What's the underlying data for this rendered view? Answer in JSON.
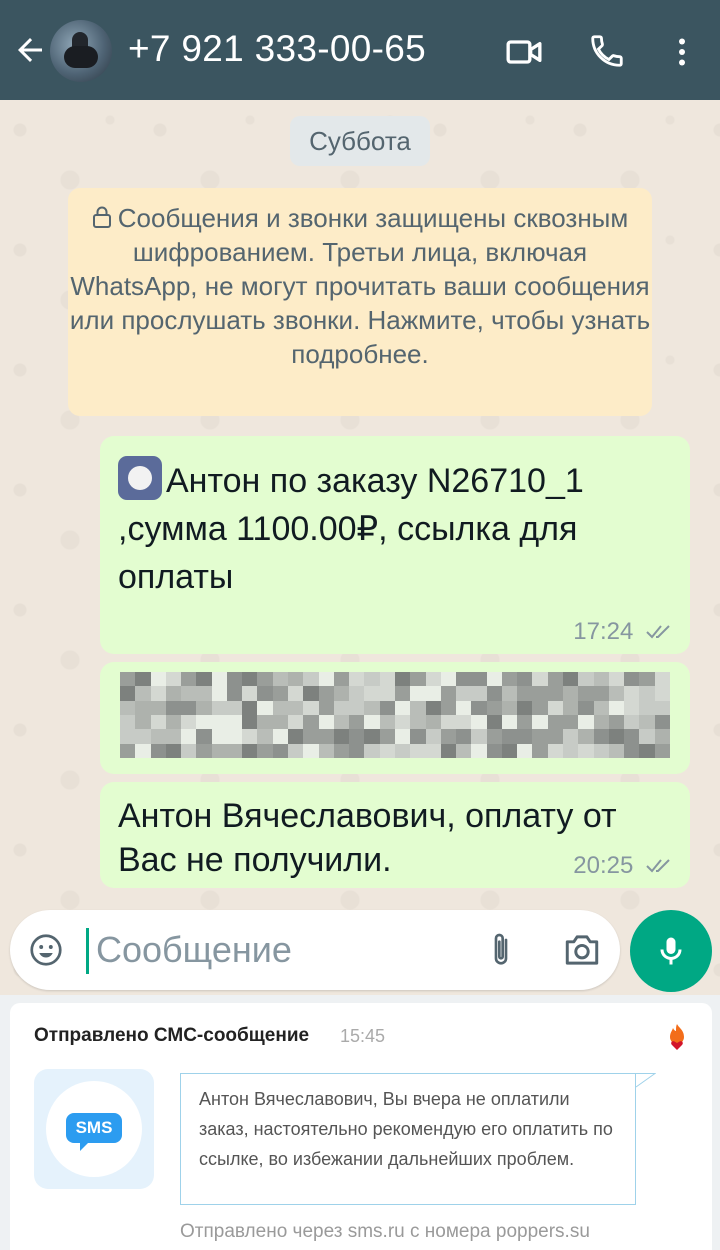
{
  "header": {
    "contact_name": "+7 921 333-00-65",
    "icons": [
      "back-arrow-icon",
      "video-call-icon",
      "phone-icon",
      "more-vert-icon"
    ],
    "bar_color": "#3b5560"
  },
  "chat": {
    "date_label": "Суббота",
    "encryption_notice": "Сообщения и звонки защищены сквозным шифрованием. Третьи лица, включая WhatsApp, не могут прочитать ваши сообщения или прослушать звонки. Нажмите, чтобы узнать подробнее.",
    "messages": [
      {
        "text": "Антон по заказу N26710_1 ,сумма 1100.00₽, ссылка для оплаты",
        "time": "17:24",
        "status": "read-double-tick",
        "emoji": "radio-button-emoji"
      },
      {
        "text": "",
        "obscured": true,
        "content": "pixelated-link"
      },
      {
        "text": "Антон Вячеславович, оплату от Вас не получили.",
        "time": "20:25",
        "status": "read-double-tick"
      }
    ],
    "bubble_color": "#e3fdd0"
  },
  "composer": {
    "placeholder": "Сообщение",
    "icons": [
      "emoji-icon",
      "attach-icon",
      "camera-icon",
      "mic-icon"
    ],
    "accent_color": "#00a884"
  },
  "notification": {
    "title": "Отправлено СМС-сообщение",
    "time": "15:45",
    "icon_label": "SMS",
    "body": "Антон Вячеславович, Вы вчера не оплатили заказ, настоятельно рекомендую его оплатить по ссылке, во избежании дальнейших проблем.",
    "footer": "Отправлено через sms.ru с номера poppers.su"
  }
}
